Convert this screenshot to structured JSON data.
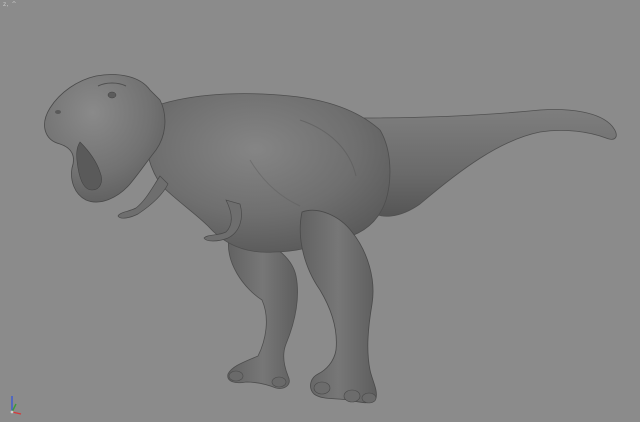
{
  "viewport": {
    "label": "z, ^",
    "background_color": "#8b8b8b",
    "model_color": "#707070",
    "model_shadow_color": "#4a4a4a",
    "model_highlight_color": "#9a9a9a"
  },
  "axis_gizmo": {
    "icon": "axis-tripod-icon",
    "x_axis_color": "#d43a3a",
    "y_axis_color": "#3a9a3a",
    "z_axis_color": "#3a5ad4"
  },
  "model": {
    "icon": "t-rex-model"
  }
}
